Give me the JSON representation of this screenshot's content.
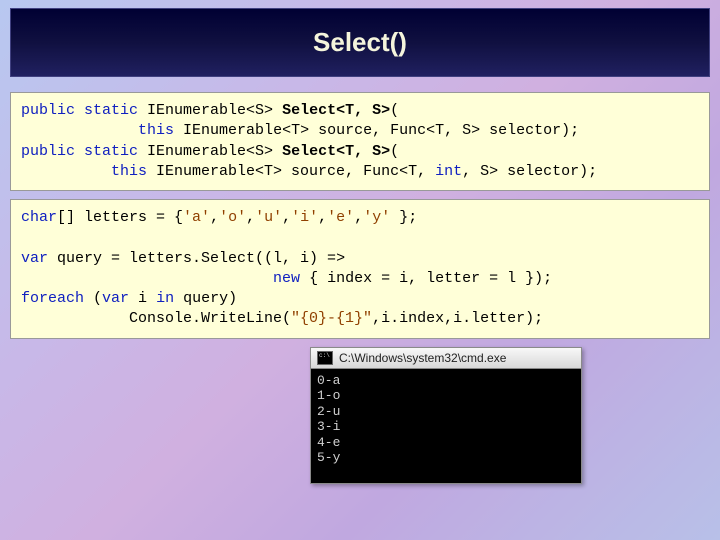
{
  "header": {
    "title": "Select()"
  },
  "code1": {
    "l1a": "public",
    "l1b": " static",
    "l1c": " IEnumerable<S> ",
    "l1d": "Select<T, S>",
    "l1e": "(",
    "l2a": "             ",
    "l2b": "this",
    "l2c": " IEnumerable<T> source, Func<T, S> selector);",
    "l3a": "public",
    "l3b": " static",
    "l3c": " IEnumerable<S> ",
    "l3d": "Select<T, S>",
    "l3e": "(",
    "l4a": "          ",
    "l4b": "this",
    "l4c": " IEnumerable<T> source, Func<T, ",
    "l4d": "int",
    "l4e": ", S> selector);"
  },
  "code2": {
    "l1a": "char",
    "l1b": "[] letters = {",
    "l1c": "'a'",
    "l1d": ",",
    "l1e": "'o'",
    "l1f": ",",
    "l1g": "'u'",
    "l1h": ",",
    "l1i": "'i'",
    "l1j": ",",
    "l1k": "'e'",
    "l1l": ",",
    "l1m": "'y'",
    "l1n": " };",
    "blank": " ",
    "l3a": "var",
    "l3b": " query = letters.Select((l, i) =>",
    "l4a": "                            ",
    "l4b": "new",
    "l4c": " { index = i, letter = l });",
    "l5a": "foreach",
    "l5b": " (",
    "l5c": "var",
    "l5d": " i ",
    "l5e": "in",
    "l5f": " query)",
    "l6a": "            Console.WriteLine(",
    "l6b": "\"{0}-{1}\"",
    "l6c": ",i.index,i.letter);"
  },
  "console": {
    "title": "C:\\Windows\\system32\\cmd.exe",
    "lines": [
      "0-a",
      "1-o",
      "2-u",
      "3-i",
      "4-e",
      "5-y"
    ]
  }
}
